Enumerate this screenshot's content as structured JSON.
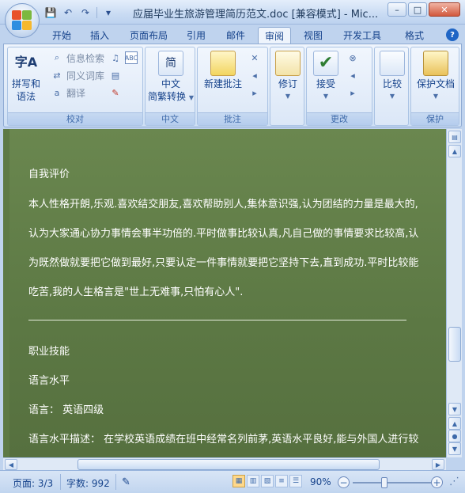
{
  "window": {
    "title": "应届毕业生旅游管理简历范文.doc [兼容模式] - Mic...",
    "minimize_glyph": "–",
    "maximize_glyph": "□",
    "close_glyph": "✕"
  },
  "qat": {
    "save_glyph": "💾",
    "undo_glyph": "↶",
    "redo_glyph": "↷",
    "customize_glyph": "▾"
  },
  "tabs": [
    {
      "label": "开始"
    },
    {
      "label": "插入"
    },
    {
      "label": "页面布局"
    },
    {
      "label": "引用"
    },
    {
      "label": "邮件"
    },
    {
      "label": "审阅",
      "active": true
    },
    {
      "label": "视图"
    },
    {
      "label": "开发工具"
    },
    {
      "label": "格式"
    }
  ],
  "ribbon": {
    "proofing": {
      "label": "校对",
      "spell_line1": "拼写和",
      "spell_line2": "语法",
      "research": "信息检索",
      "thesaurus": "同义词库",
      "translate": "翻译"
    },
    "chinese": {
      "label": "中文",
      "line1": "中文",
      "line2": "简繁转换"
    },
    "comments": {
      "label": "批注",
      "new_comment": "新建批注"
    },
    "tracking": {
      "label": "修订",
      "line1": "修订"
    },
    "changes": {
      "label": "更改",
      "accept": "接受"
    },
    "compare": {
      "label": "比较",
      "line1": "比较"
    },
    "protect": {
      "label": "保护",
      "line1": "保护文档"
    }
  },
  "document": {
    "lines": [
      "自我评价",
      "本人性格开朗,乐观.喜欢结交朋友,喜欢帮助别人,集体意识强,认为团结的力量是最大的,",
      "认为大家通心协力事情会事半功倍的.平时做事比较认真,凡自己做的事情要求比较高,认",
      "为既然做就要把它做到最好,只要认定一件事情就要把它坚持下去,直到成功.平时比较能",
      "吃苦,我的人生格言是\"世上无难事,只怕有心人\".",
      "职业技能",
      "语言水平",
      "语言：  英语四级",
      "语言水平描述：  在学校英语成绩在班中经常名列前茅,英语水平良好,能与外国人进行较"
    ]
  },
  "statusbar": {
    "page": "页面: 3/3",
    "words": "字数: 992",
    "zoom": "90%",
    "zoom_minus": "−",
    "zoom_plus": "+"
  }
}
